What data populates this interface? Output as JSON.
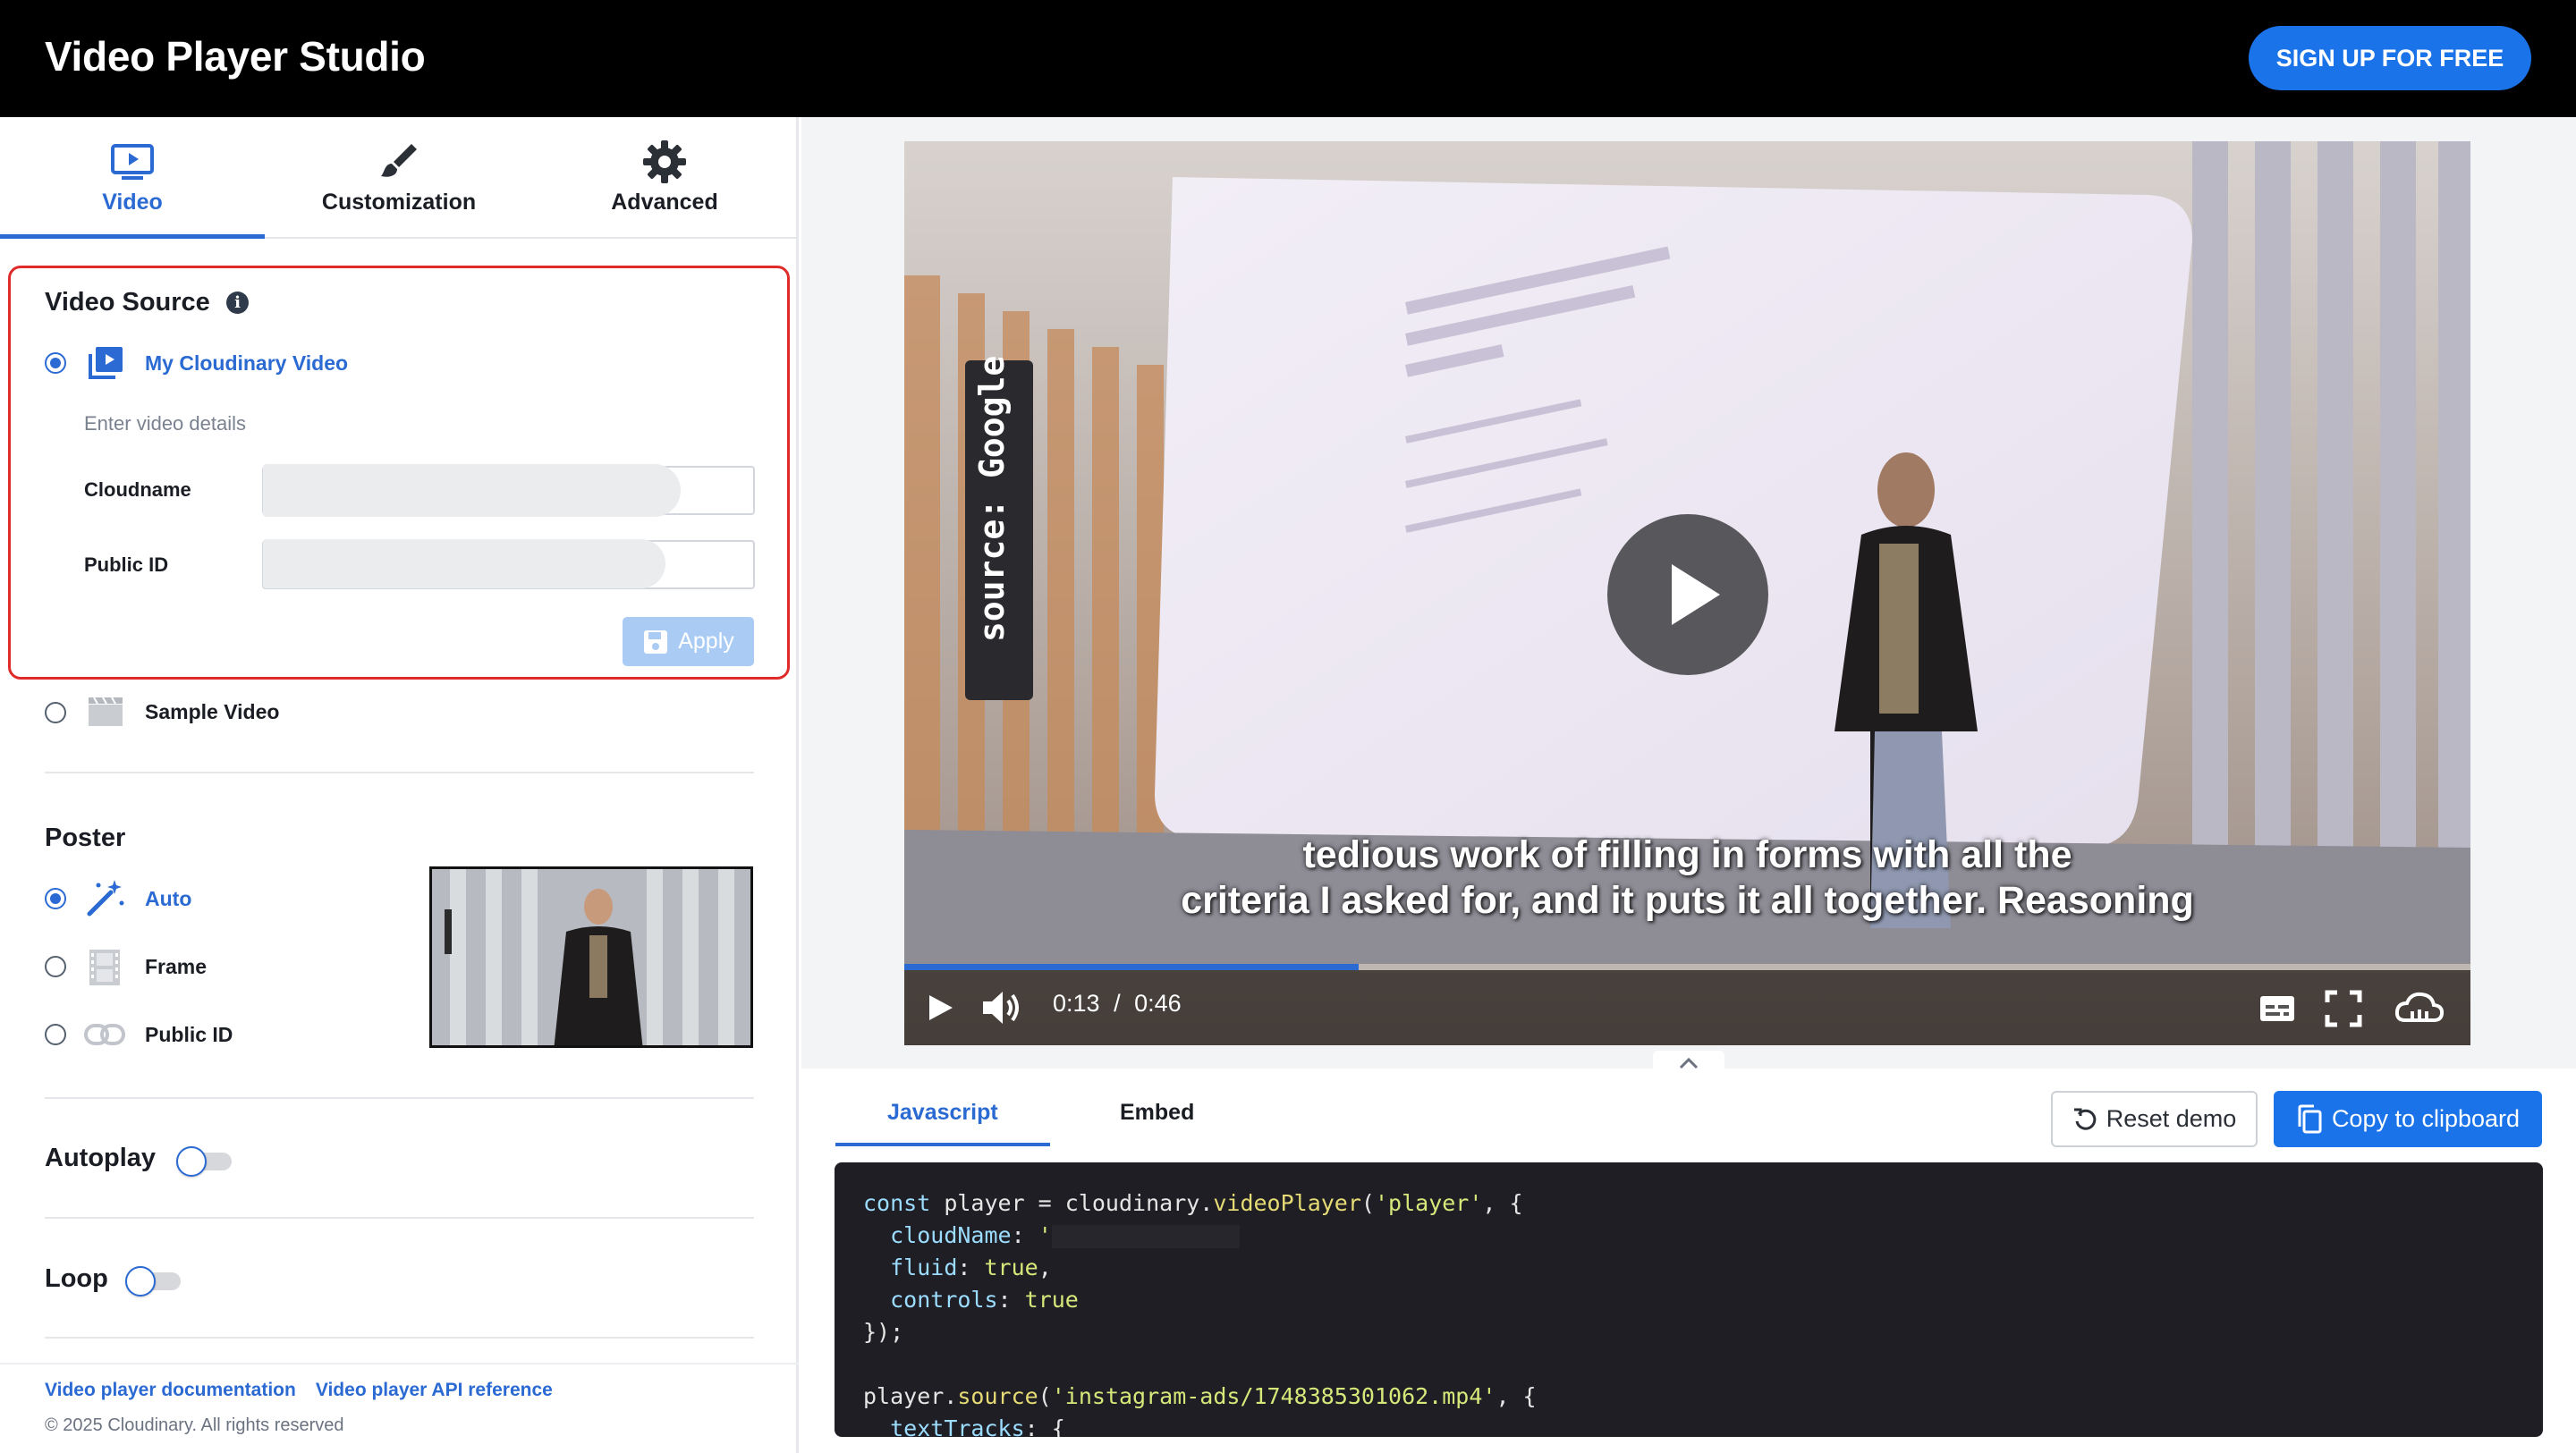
{
  "header": {
    "title": "Video Player Studio",
    "signup_label": "SIGN UP FOR FREE"
  },
  "sidebar": {
    "tabs": [
      {
        "label": "Video",
        "icon": "video-icon",
        "active": true
      },
      {
        "label": "Customization",
        "icon": "brush-icon",
        "active": false
      },
      {
        "label": "Advanced",
        "icon": "gear-icon",
        "active": false
      }
    ],
    "video_source": {
      "title": "Video Source",
      "options": {
        "my_cloudinary": "My Cloudinary Video",
        "sample": "Sample Video"
      },
      "hint": "Enter video details",
      "cloudname_label": "Cloudname",
      "public_id_label": "Public ID",
      "apply_label": "Apply"
    },
    "poster": {
      "title": "Poster",
      "options": [
        "Auto",
        "Frame",
        "Public ID"
      ],
      "selected": "Auto"
    },
    "autoplay": {
      "label": "Autoplay",
      "on": false
    },
    "loop": {
      "label": "Loop",
      "on": false
    },
    "footer": {
      "docs_link": "Video player documentation",
      "api_link": "Video player API reference",
      "copyright": "© 2025 Cloudinary. All rights reserved"
    }
  },
  "player": {
    "subtitle_line1": "tedious work of filling in forms with all the",
    "subtitle_line2": "criteria I asked for, and it puts it all together. Reasoning",
    "watermark": "source: Google",
    "current_time": "0:13",
    "separator": "/",
    "duration": "0:46",
    "progress_fraction": 0.29
  },
  "code_panel": {
    "tabs": [
      "Javascript",
      "Embed"
    ],
    "active_tab": "Javascript",
    "reset_label": "Reset demo",
    "copy_label": "Copy to clipboard",
    "lines": [
      "const player = cloudinary.videoPlayer('player', {",
      "  cloudName: '",
      "  fluid: true,",
      "  controls: true",
      "});",
      "",
      "player.source('instagram-ads/1748385301062.mp4', {",
      "  textTracks: {"
    ]
  },
  "colors": {
    "accent": "#2a6ad2",
    "header_bg": "#000000",
    "signup_bg": "#1a73e8",
    "highlight_border": "#e02b2b"
  }
}
